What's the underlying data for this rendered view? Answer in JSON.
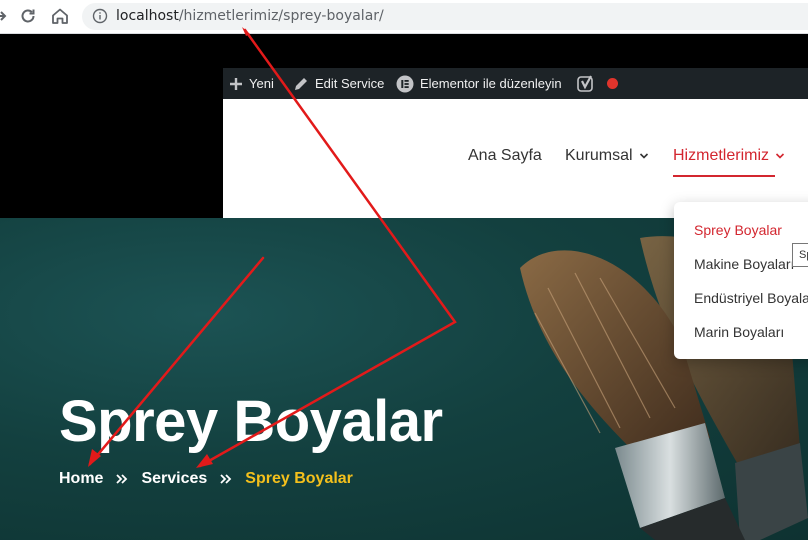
{
  "browser": {
    "url_host": "localhost",
    "url_path": "/hizmetlerimiz/sprey-boyalar/"
  },
  "admin_bar": {
    "new_label": "Yeni",
    "edit_label": "Edit Service",
    "elementor_label": "Elementor ile düzenleyin",
    "status_color": "#e0342c"
  },
  "menu": {
    "items": [
      "Ana Sayfa",
      "Kurumsal",
      "Hizmetlerimiz"
    ],
    "active_color": "#d3262f"
  },
  "dropdown": {
    "items": [
      "Sprey Boyalar",
      "Makine Boyaları",
      "Endüstriyel Boyalar",
      "Marin Boyaları"
    ],
    "tooltip": "Sp"
  },
  "hero": {
    "title": "Sprey Boyalar",
    "breadcrumb": [
      "Home",
      "Services",
      "Sprey Boyalar"
    ],
    "current_color": "#f4c01c"
  },
  "annotation_color": "#e21a1a"
}
